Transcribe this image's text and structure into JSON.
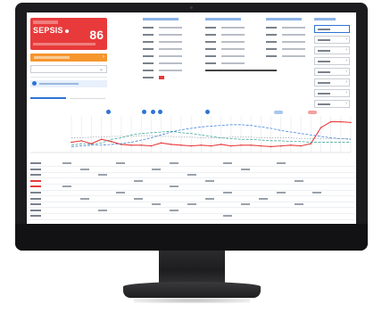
{
  "sepsis_card": {
    "title": "SEPSIS",
    "score": "86",
    "colors": {
      "background": "#e83a3a",
      "text": "#ffffff"
    }
  },
  "alert_bar": {
    "label": "",
    "color": "#f5962e"
  },
  "select": {
    "value": ""
  },
  "info_banner": {
    "text": ""
  },
  "tabs": [
    {
      "label": ""
    },
    {
      "label": ""
    }
  ],
  "chart_data": {
    "type": "line",
    "title": "",
    "xlabel": "",
    "ylabel": "",
    "grid": true,
    "x": [
      0,
      1,
      2,
      3,
      4,
      5,
      6,
      7,
      8,
      9,
      10,
      11,
      12,
      13,
      14,
      15,
      16,
      17,
      18,
      19,
      20,
      21,
      22,
      23,
      24,
      25,
      26,
      27,
      28
    ],
    "series": [
      {
        "color": "#e83a3a",
        "values": [
          14,
          16,
          12,
          18,
          15,
          11,
          10,
          10,
          9,
          13,
          11,
          10,
          9,
          10,
          9,
          11,
          9,
          10,
          10,
          9,
          8,
          9,
          10,
          9,
          12,
          34,
          42,
          42,
          41
        ]
      },
      {
        "color": "#2a9d8f",
        "values": [
          10,
          12,
          11,
          13,
          18,
          20,
          24,
          26,
          27,
          28,
          29,
          27,
          26,
          24,
          22,
          20,
          19,
          18,
          18,
          17,
          16,
          16,
          15,
          15,
          14,
          14,
          14,
          14,
          14
        ]
      },
      {
        "color": "#2d74d6",
        "values": [
          8,
          9,
          10,
          10,
          11,
          12,
          14,
          17,
          20,
          24,
          28,
          31,
          33,
          35,
          36,
          37,
          38,
          38,
          37,
          35,
          33,
          30,
          28,
          26,
          24,
          22,
          20,
          19,
          18
        ]
      },
      {
        "color": "#9aa1aa",
        "values": [
          20,
          20,
          21,
          21,
          22,
          22,
          22,
          23,
          23,
          22,
          22,
          21,
          21,
          20,
          20,
          20,
          21,
          21,
          21,
          20,
          20,
          20,
          20,
          19,
          19,
          19,
          19,
          19,
          19
        ]
      }
    ],
    "ylim": [
      0,
      50
    ]
  }
}
